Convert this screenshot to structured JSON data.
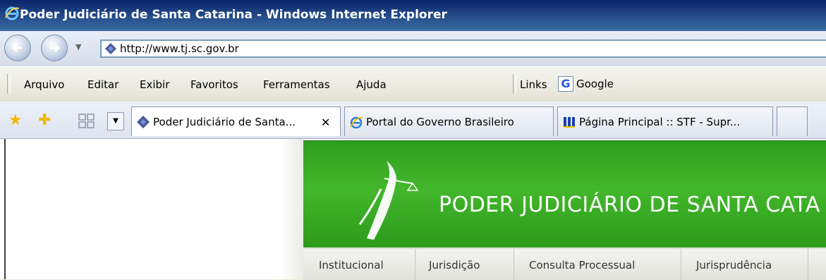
{
  "window": {
    "title": "Poder Judiciário de Santa Catarina - Windows Internet Explorer"
  },
  "address": {
    "url": "http://www.tj.sc.gov.br"
  },
  "menu": {
    "items": [
      "Arquivo",
      "Editar",
      "Exibir",
      "Favoritos",
      "Ferramentas",
      "Ajuda"
    ],
    "links_label": "Links",
    "google_label": "Google"
  },
  "tabs": [
    {
      "label": "Poder Judiciário de Santa...",
      "active": true
    },
    {
      "label": "Portal do Governo Brasileiro",
      "active": false
    },
    {
      "label": "Página Principal :: STF - Supr...",
      "active": false
    }
  ],
  "site": {
    "title": "PODER JUDICIÁRIO DE SANTA CATA",
    "nav": [
      "Institucional",
      "Jurisdição",
      "Consulta Processual",
      "Jurisprudência"
    ]
  },
  "colors": {
    "titlebar": "#0a246a",
    "banner_green": "#3aa725",
    "address_border": "#7f9db9"
  }
}
